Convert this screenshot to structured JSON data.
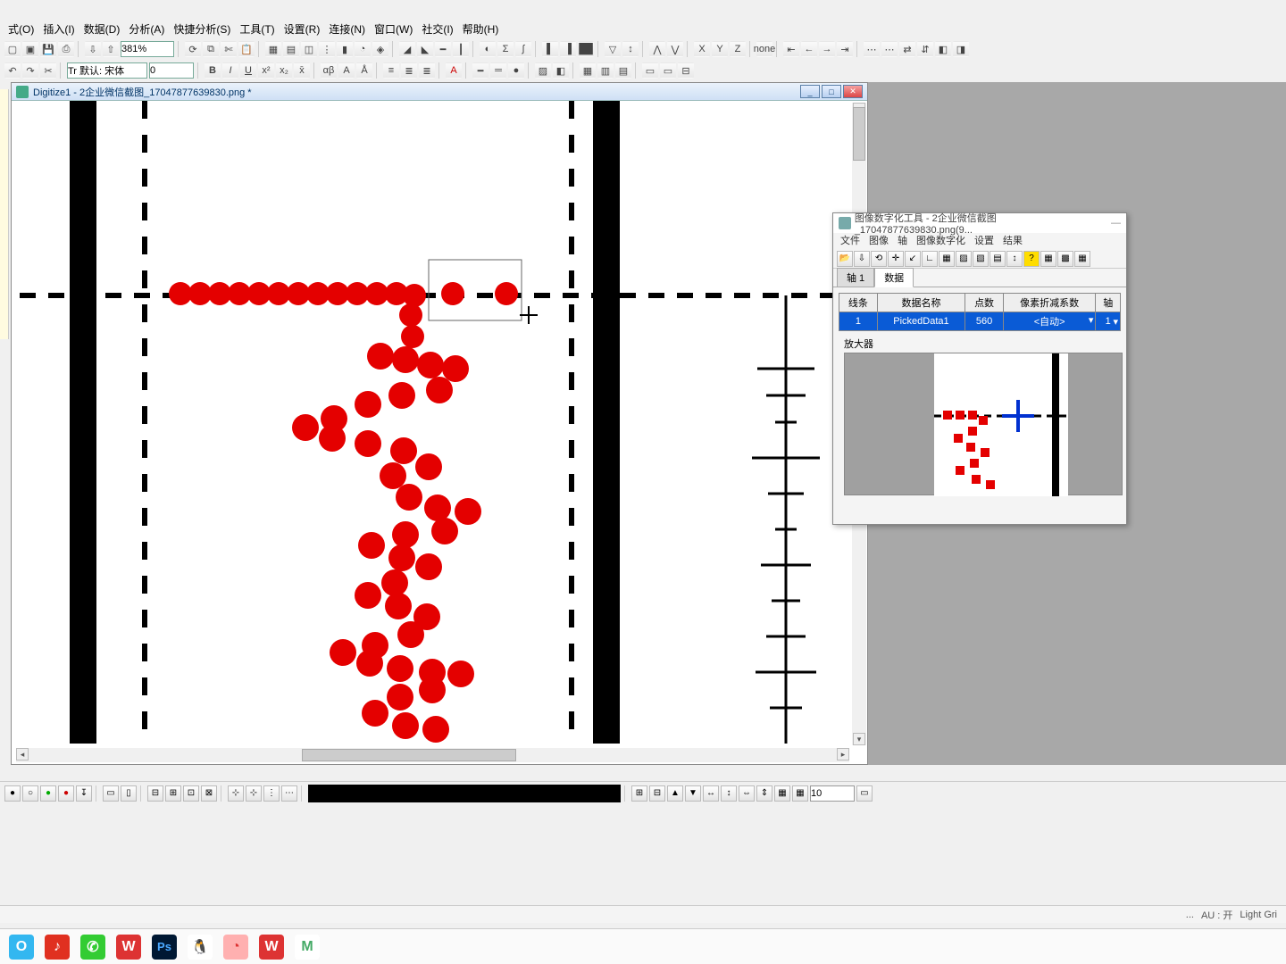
{
  "menu": {
    "items": [
      "式(O)",
      "插入(I)",
      "数据(D)",
      "分析(A)",
      "快捷分析(S)",
      "工具(T)",
      "设置(R)",
      "连接(N)",
      "窗口(W)",
      "社交(I)",
      "帮助(H)"
    ]
  },
  "toolbar1": {
    "zoom": "381%"
  },
  "toolbar2": {
    "font_mode": "Tr 默认: 宋体",
    "font_size": "0",
    "bold": "B",
    "italic": "I",
    "underline": "U"
  },
  "doc": {
    "title": "Digitize1 - 2企业微信截图_17047877639830.png *",
    "win_min": "_",
    "win_max": "□",
    "win_close": "✕"
  },
  "dialog": {
    "title": "图像数字化工具 - 2企业微信截图_17047877639830.png(9...",
    "menus": [
      "文件",
      "图像",
      "轴",
      "图像数字化",
      "设置",
      "结果"
    ],
    "tabs": [
      "轴 1",
      "数据"
    ],
    "active_tab": 1,
    "table": {
      "headers": [
        "线条",
        "数据名称",
        "点数",
        "像素折减系数",
        "轴"
      ],
      "row": {
        "line": "1",
        "name": "PickedData1",
        "count": "560",
        "factor": "<自动>",
        "axis": "1"
      }
    },
    "magnifier": "放大器"
  },
  "bottom": {
    "val": "10"
  },
  "status": {
    "dots": "...",
    "au": "AU : 开",
    "grid": "Light Gri"
  },
  "taskbar_apps": [
    {
      "label": "O",
      "bg": "#33b7f0",
      "fg": "#fff"
    },
    {
      "label": "♪",
      "bg": "#e03020",
      "fg": "#fff"
    },
    {
      "label": "✆",
      "bg": "#3c3",
      "fg": "#fff"
    },
    {
      "label": "W",
      "bg": "#d33",
      "fg": "#fff"
    },
    {
      "label": "Ps",
      "bg": "#001833",
      "fg": "#4aa8ff"
    },
    {
      "label": "🐧",
      "bg": "#fff",
      "fg": "#000"
    },
    {
      "label": "◔",
      "bg": "#ffb0b0",
      "fg": "#d33"
    },
    {
      "label": "W",
      "bg": "#d33",
      "fg": "#fff"
    },
    {
      "label": "M",
      "bg": "#fff",
      "fg": "#4a6"
    }
  ]
}
